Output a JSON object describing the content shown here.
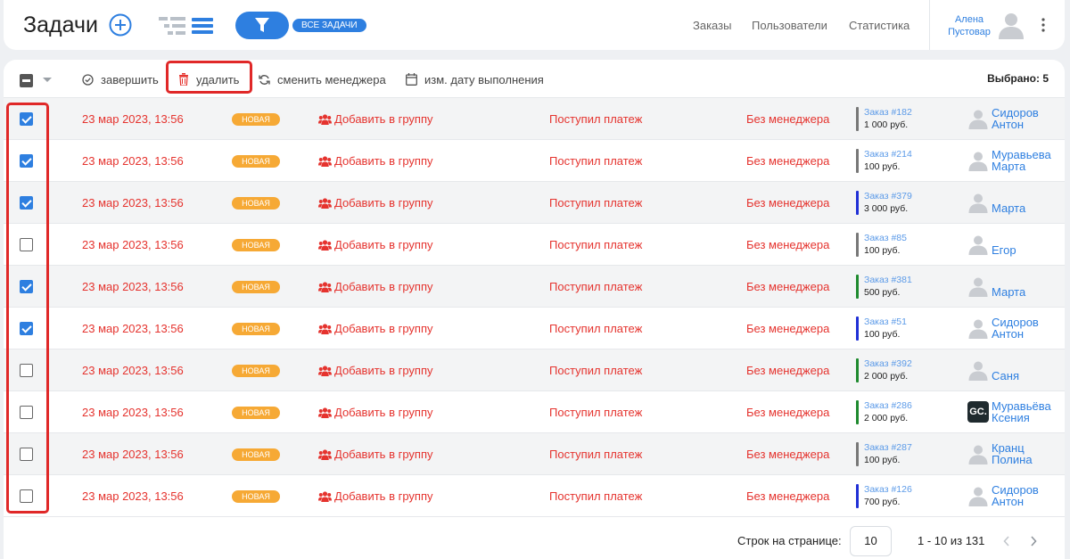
{
  "header": {
    "title": "Задачи",
    "all_tasks_badge": "ВСЕ ЗАДАЧИ",
    "nav": {
      "orders": "Заказы",
      "users": "Пользователи",
      "stats": "Статистика"
    },
    "user": {
      "first_name": "Алена",
      "last_name": "Пустовар"
    },
    "icons": [
      "plus-circle-icon",
      "tree-view-icon",
      "list-view-icon",
      "filter-icon",
      "user-avatar-icon",
      "kebab-menu-icon"
    ]
  },
  "toolbar": {
    "complete_label": "завершить",
    "delete_label": "удалить",
    "change_manager_label": "сменить менеджера",
    "change_date_label": "изм. дату выполнения",
    "selected_label": "Выбрано: 5"
  },
  "rows": [
    {
      "checked": true,
      "date": "23 мар 2023, 13:56",
      "status": "НОВАЯ",
      "group": "Добавить в группу",
      "event": "Поступил платеж",
      "manager": "Без менеджера",
      "order": "Заказ #182",
      "sum": "1 000 руб.",
      "bar_color": "#777777",
      "name1": "Сидоров",
      "name2": "Антон",
      "avatar": "person"
    },
    {
      "checked": true,
      "date": "23 мар 2023, 13:56",
      "status": "НОВАЯ",
      "group": "Добавить в группу",
      "event": "Поступил платеж",
      "manager": "Без менеджера",
      "order": "Заказ #214",
      "sum": "100 руб.",
      "bar_color": "#777777",
      "name1": "Муравьева",
      "name2": "Марта",
      "avatar": "person"
    },
    {
      "checked": true,
      "date": "23 мар 2023, 13:56",
      "status": "НОВАЯ",
      "group": "Добавить в группу",
      "event": "Поступил платеж",
      "manager": "Без менеджера",
      "order": "Заказ #379",
      "sum": "3 000 руб.",
      "bar_color": "#1f2fd6",
      "name1": "Марта",
      "name2": "",
      "avatar": "person"
    },
    {
      "checked": false,
      "date": "23 мар 2023, 13:56",
      "status": "НОВАЯ",
      "group": "Добавить в группу",
      "event": "Поступил платеж",
      "manager": "Без менеджера",
      "order": "Заказ #85",
      "sum": "100 руб.",
      "bar_color": "#777777",
      "name1": "Егор",
      "name2": "",
      "avatar": "person"
    },
    {
      "checked": true,
      "date": "23 мар 2023, 13:56",
      "status": "НОВАЯ",
      "group": "Добавить в группу",
      "event": "Поступил платеж",
      "manager": "Без менеджера",
      "order": "Заказ #381",
      "sum": "500 руб.",
      "bar_color": "#1e8a2e",
      "name1": "Марта",
      "name2": "",
      "avatar": "person"
    },
    {
      "checked": true,
      "date": "23 мар 2023, 13:56",
      "status": "НОВАЯ",
      "group": "Добавить в группу",
      "event": "Поступил платеж",
      "manager": "Без менеджера",
      "order": "Заказ #51",
      "sum": "100 руб.",
      "bar_color": "#1f2fd6",
      "name1": "Сидоров",
      "name2": "Антон",
      "avatar": "person"
    },
    {
      "checked": false,
      "date": "23 мар 2023, 13:56",
      "status": "НОВАЯ",
      "group": "Добавить в группу",
      "event": "Поступил платеж",
      "manager": "Без менеджера",
      "order": "Заказ #392",
      "sum": "2 000 руб.",
      "bar_color": "#1e8a2e",
      "name1": "Саня",
      "name2": "",
      "avatar": "person"
    },
    {
      "checked": false,
      "date": "23 мар 2023, 13:56",
      "status": "НОВАЯ",
      "group": "Добавить в группу",
      "event": "Поступил платеж",
      "manager": "Без менеджера",
      "order": "Заказ #286",
      "sum": "2 000 руб.",
      "bar_color": "#1e8a2e",
      "name1": "Муравьёва",
      "name2": "Ксения",
      "avatar": "gc",
      "avatar_text": "GC."
    },
    {
      "checked": false,
      "date": "23 мар 2023, 13:56",
      "status": "НОВАЯ",
      "group": "Добавить в группу",
      "event": "Поступил платеж",
      "manager": "Без менеджера",
      "order": "Заказ #287",
      "sum": "100 руб.",
      "bar_color": "#777777",
      "name1": "Кранц",
      "name2": "Полина",
      "avatar": "person"
    },
    {
      "checked": false,
      "date": "23 мар 2023, 13:56",
      "status": "НОВАЯ",
      "group": "Добавить в группу",
      "event": "Поступил платеж",
      "manager": "Без менеджера",
      "order": "Заказ #126",
      "sum": "700 руб.",
      "bar_color": "#1f2fd6",
      "name1": "Сидоров",
      "name2": "Антон",
      "avatar": "person"
    }
  ],
  "pager": {
    "rows_label": "Строк на странице:",
    "rows_value": "10",
    "range": "1 - 10 из 131"
  },
  "colors": {
    "accent": "#2e7fe0",
    "danger": "#e5332e",
    "status_new": "#f6a935",
    "highlight": "#e02828"
  }
}
